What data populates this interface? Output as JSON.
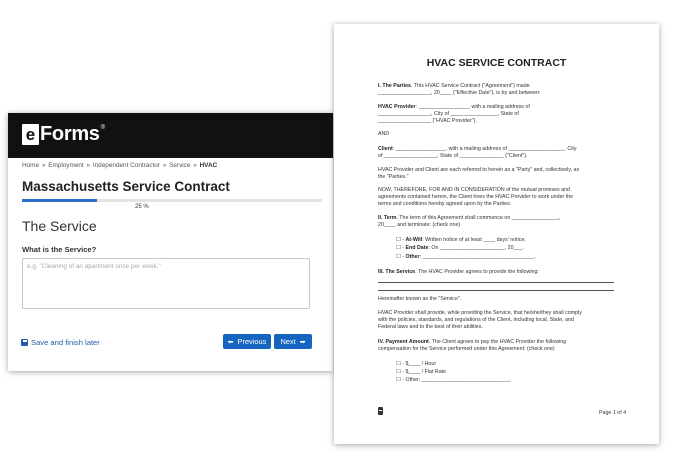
{
  "form": {
    "logo": {
      "e": "e",
      "rest": "Forms",
      "reg": "®"
    },
    "breadcrumb": [
      "Home",
      "Employment",
      "Independent Contractor",
      "Service"
    ],
    "breadcrumb_current": "HVAC",
    "breadcrumb_sep": "»",
    "title": "Massachusetts Service Contract",
    "progress_label": "25 %",
    "progress_value": 0.25,
    "section_title": "The Service",
    "question": "What is the Service?",
    "answer_placeholder": "e.g. \"Cleaning of an apartment once per week.\"",
    "save_later": "Save and finish later",
    "previous_label": "Previous",
    "next_label": "Next",
    "prev_arrow": "⬅",
    "next_arrow": "➡",
    "accent": "#1565c0"
  },
  "document": {
    "title": "HVAC SERVICE CONTRACT",
    "parties_head": "I. The Parties",
    "parties_text": ". This HVAC Service Contract (\"Agreement\") made",
    "parties_line2": "__________________, 20____ (\"Effective Date\"), is by and between:",
    "provider_head": "HVAC Provider",
    "provider_line1": ": _________________, with a mailing address of",
    "provider_line2": "__________________, City of ________________, State of",
    "provider_line3": "__________________ (\"HVAC Provider\"),",
    "and": "AND",
    "client_head": "Client",
    "client_line1": ": _________________, with a mailing address of ___________________, City",
    "client_line2": "of __________________, State of _______________ (\"Client\").",
    "party_line1": "HVAC Provider and Client are each referred to herein as a \"Party\" and, collectively, as",
    "party_line2": "the \"Parties.\"",
    "now_line1": "NOW, THEREFORE, FOR AND IN CONSIDERATION of the mutual promises and",
    "now_line2": "agreements contained herein, the Client hires the HVAC Provider to work under the",
    "now_line3": "terms and conditions hereby agreed upon by the Parties:",
    "term_head": "II. Term",
    "term_line1": ". The term of this Agreement shall commence on ________________,",
    "term_line2": "20____ and terminate: (check one)",
    "term_opt1_head": "At-Will",
    "term_opt1": ": Written notice of at least ____ days' notice.",
    "term_opt2_head": "End Date",
    "term_opt2": ": On ______________________, 20___.",
    "term_opt3_head": "Other",
    "term_opt3": ": ______________________________________.",
    "checkbox": "☐ -",
    "service_head": "III. The Service",
    "service_text": ". The HVAC Provider agrees to provide the following:",
    "hereinafter": "Hereinafter known as the \"Service\".",
    "provide_line1": "HVAC Provider shall provide, while providing the Service, that he/she/they shall comply",
    "provide_line2": "with the policies, standards, and regulations of the Client, including local, State, and",
    "provide_line3": "Federal laws and to the best of their abilities.",
    "pay_head": "IV. Payment Amount",
    "pay_line1": ". The Client agrees to pay the HVAC Provider the following",
    "pay_line2": "compensation for the Service performed under this Agreement: (check one)",
    "pay_opt1": "☐ - $____ / Hour",
    "pay_opt2": "☐ - $____ / Flat Rate",
    "pay_opt3": "☐ - Other: ______________________________.",
    "page_num": "Page 1 of 4"
  }
}
